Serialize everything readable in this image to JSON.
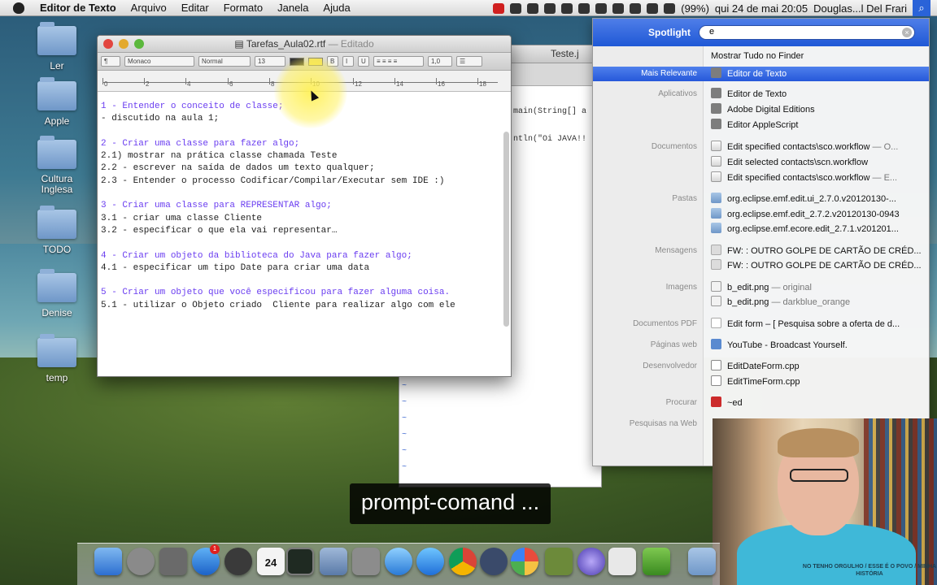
{
  "menubar": {
    "app_name": "Editor de Texto",
    "menus": [
      "Arquivo",
      "Editar",
      "Formato",
      "Janela",
      "Ajuda"
    ],
    "battery": "(99%)",
    "datetime": "qui 24 de mai  20:05",
    "user": "Douglas...l Del Frari"
  },
  "desktop": {
    "folders": [
      "Ler",
      "Apple",
      "Cultura Inglesa",
      "TODO",
      "Denise",
      "temp"
    ]
  },
  "back_window": {
    "title": "Teste.j",
    "code_lines": [
      "main(String[] a",
      "ntln(\"Oi JAVA!!"
    ]
  },
  "editor": {
    "title": "Tarefas_Aula02.rtf",
    "status": "— Editado",
    "format_bar": {
      "font_family": "Monaco",
      "font_style": "Normal",
      "font_size": "13",
      "line_spacing": "1,0"
    },
    "ruler_ticks": [
      "0",
      "2",
      "4",
      "6",
      "8",
      "10",
      "12",
      "14",
      "16",
      "18"
    ],
    "lines": [
      {
        "text": "1 - Entender o conceito de classe;",
        "heading": true
      },
      {
        "text": "- discutido na aula 1;",
        "heading": false
      },
      {
        "text": "",
        "heading": false
      },
      {
        "text": "2 - Criar uma classe para fazer algo;",
        "heading": true
      },
      {
        "text": "2.1) mostrar na prática classe chamada Teste",
        "heading": false
      },
      {
        "text": "2.2 - escrever na saída de dados um texto qualquer;",
        "heading": false
      },
      {
        "text": "2.3 - Entender o processo Codificar/Compilar/Executar sem IDE :)",
        "heading": false
      },
      {
        "text": "",
        "heading": false
      },
      {
        "text": "3 - Criar uma classe para REPRESENTAR algo;",
        "heading": true
      },
      {
        "text": "3.1 - criar uma classe Cliente",
        "heading": false
      },
      {
        "text": "3.2 - especificar o que ela vai representar…",
        "heading": false
      },
      {
        "text": "",
        "heading": false
      },
      {
        "text": "4 - Criar um objeto da biblioteca do Java para fazer algo;",
        "heading": true
      },
      {
        "text": "4.1 - especificar um tipo Date para criar uma data",
        "heading": false
      },
      {
        "text": "",
        "heading": false
      },
      {
        "text": "5 - Criar um objeto que você especificou para fazer alguma coisa.",
        "heading": true
      },
      {
        "text": "5.1 - utilizar o Objeto criado  Cliente para realizar algo com ele",
        "heading": false
      }
    ]
  },
  "spotlight": {
    "label": "Spotlight",
    "query": "e",
    "show_all": "Mostrar Tudo no Finder",
    "rows": [
      {
        "category": "Mais Relevante",
        "item": "Editor de Texto",
        "meta": "",
        "icon": "app-icon",
        "selected": true
      },
      {
        "category": "Aplicativos",
        "item": "Editor de Texto",
        "meta": "",
        "icon": "app-icon",
        "selected": false
      },
      {
        "category": "",
        "item": "Adobe Digital Editions",
        "meta": "",
        "icon": "app-icon",
        "selected": false
      },
      {
        "category": "",
        "item": "Editor AppleScript",
        "meta": "",
        "icon": "app-icon",
        "selected": false
      },
      {
        "category": "Documentos",
        "item": "Edit specified contacts\\sco.workflow",
        "meta": " — O...",
        "icon": "doc-icon",
        "selected": false
      },
      {
        "category": "",
        "item": "Edit selected contacts\\scn.workflow",
        "meta": "",
        "icon": "doc-icon",
        "selected": false
      },
      {
        "category": "",
        "item": "Edit specified contacts\\sco.workflow",
        "meta": " — E...",
        "icon": "doc-icon",
        "selected": false
      },
      {
        "category": "Pastas",
        "item": "org.eclipse.emf.edit.ui_2.7.0.v20120130-...",
        "meta": "",
        "icon": "folder-icon",
        "selected": false
      },
      {
        "category": "",
        "item": "org.eclipse.emf.edit_2.7.2.v20120130-0943",
        "meta": "",
        "icon": "folder-icon",
        "selected": false
      },
      {
        "category": "",
        "item": "org.eclipse.emf.ecore.edit_2.7.1.v201201...",
        "meta": "",
        "icon": "folder-icon",
        "selected": false
      },
      {
        "category": "Mensagens",
        "item": "FW: : OUTRO GOLPE DE CARTÃO DE CRÉD...",
        "meta": "",
        "icon": "mail-icon",
        "selected": false
      },
      {
        "category": "",
        "item": "FW: : OUTRO GOLPE DE CARTÃO DE CRÉD...",
        "meta": "",
        "icon": "mail-icon",
        "selected": false
      },
      {
        "category": "Imagens",
        "item": "b_edit.png",
        "meta": " — original",
        "icon": "image-icon",
        "selected": false
      },
      {
        "category": "",
        "item": "b_edit.png",
        "meta": " — darkblue_orange",
        "icon": "image-icon",
        "selected": false
      },
      {
        "category": "Documentos PDF",
        "item": "Edit form – [ Pesquisa sobre a oferta de d...",
        "meta": "",
        "icon": "pdf-icon",
        "selected": false
      },
      {
        "category": "Páginas web",
        "item": "YouTube - Broadcast Yourself.",
        "meta": "",
        "icon": "web-icon",
        "selected": false
      },
      {
        "category": "Desenvolvedor",
        "item": "EditDateForm.cpp",
        "meta": "",
        "icon": "cpp-icon",
        "selected": false
      },
      {
        "category": "",
        "item": "EditTimeForm.cpp",
        "meta": "",
        "icon": "cpp-icon",
        "selected": false
      },
      {
        "category": "Procurar",
        "item": "~ed",
        "meta": "",
        "icon": "dictionary-icon",
        "selected": false
      },
      {
        "category": "Pesquisas na Web",
        "item": "",
        "meta": "",
        "icon": "",
        "selected": false
      }
    ]
  },
  "webcam": {
    "shirt_text": "NO TENHO ORGULHO / ESSE É O POVO / MINHA HISTÓRIA"
  },
  "caption": "prompt-comand ...",
  "dock": {
    "calendar_day": "24",
    "badge_count": "1"
  }
}
